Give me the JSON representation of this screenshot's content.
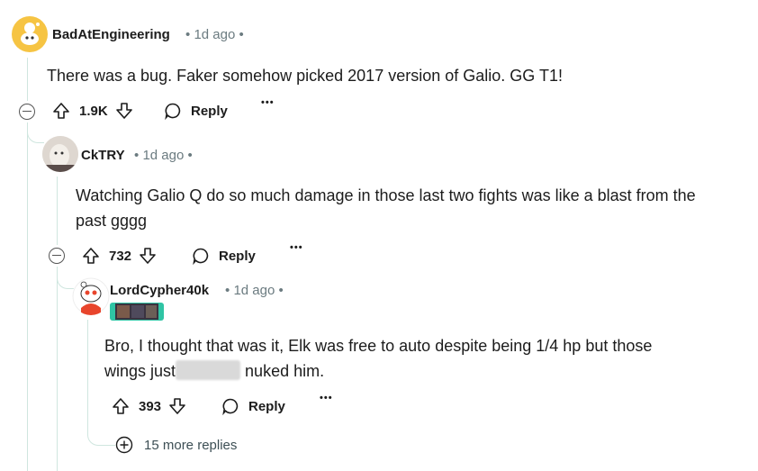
{
  "comments": [
    {
      "username": "BadAtEngineering",
      "time": "1d ago",
      "body": "There was a bug. Faker somehow picked 2017 version of Galio. GG T1!",
      "votes": "1.9K",
      "reply_label": "Reply",
      "more": "•••"
    },
    {
      "username": "CkTRY",
      "time": "1d ago",
      "body_line1": "Watching Galio Q do so much damage in those last two fights was like a blast from the",
      "body_line2": "past gggg",
      "votes": "732",
      "reply_label": "Reply",
      "more": "•••"
    },
    {
      "username": "LordCypher40k",
      "time": "1d ago",
      "body_line1": "Bro, I thought that was it, Elk was free to auto despite being 1/4 hp but those",
      "body_line2_before": "wings just",
      "body_line2_after": "nuked him.",
      "votes": "393",
      "reply_label": "Reply",
      "more": "•••"
    }
  ],
  "more_replies": "15 more replies",
  "separator": "•",
  "colors": {
    "thread_line": "#cfe6df",
    "meta": "#6b7b80",
    "avatar_yellow": "#f6c443"
  }
}
